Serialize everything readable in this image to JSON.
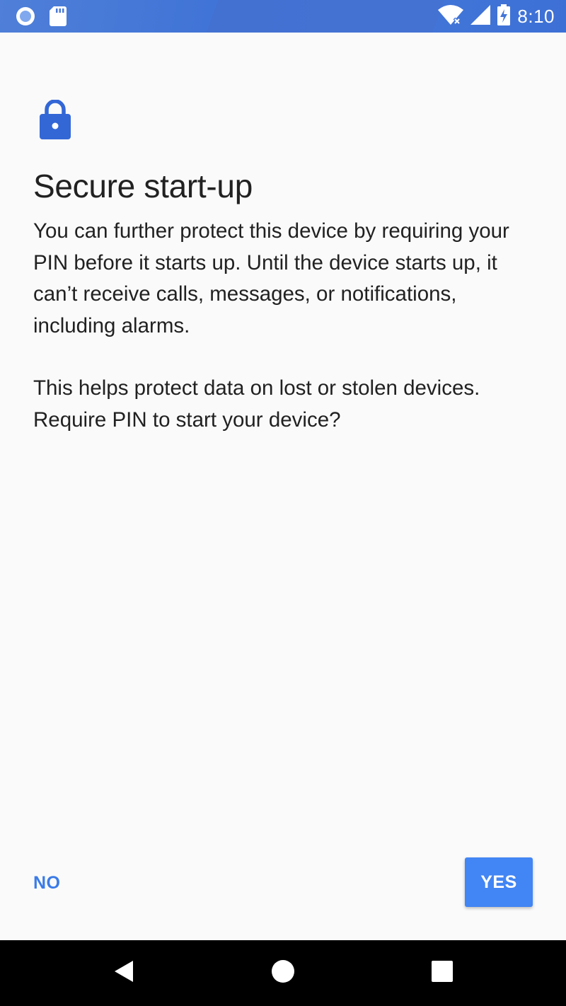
{
  "status_bar": {
    "time": "8:10",
    "left_icons": [
      "circle-notification-icon",
      "sd-card-icon"
    ],
    "right_icons": [
      "wifi-icon",
      "signal-icon",
      "battery-charging-icon"
    ],
    "background_color": "#4376d8"
  },
  "setup": {
    "icon": "lock-icon",
    "title": "Secure start-up",
    "paragraph1": "You can further protect this device by requiring your PIN before it starts up. Until the device starts up, it can’t receive calls, messages, or notifications, including alarms.",
    "paragraph2": "This helps protect data on lost or stolen devices. Require PIN to start your device?"
  },
  "actions": {
    "no_label": "NO",
    "yes_label": "YES",
    "accent_color": "#4285f4"
  },
  "nav_bar": {
    "icons": [
      "back-icon",
      "home-icon",
      "recents-icon"
    ]
  }
}
